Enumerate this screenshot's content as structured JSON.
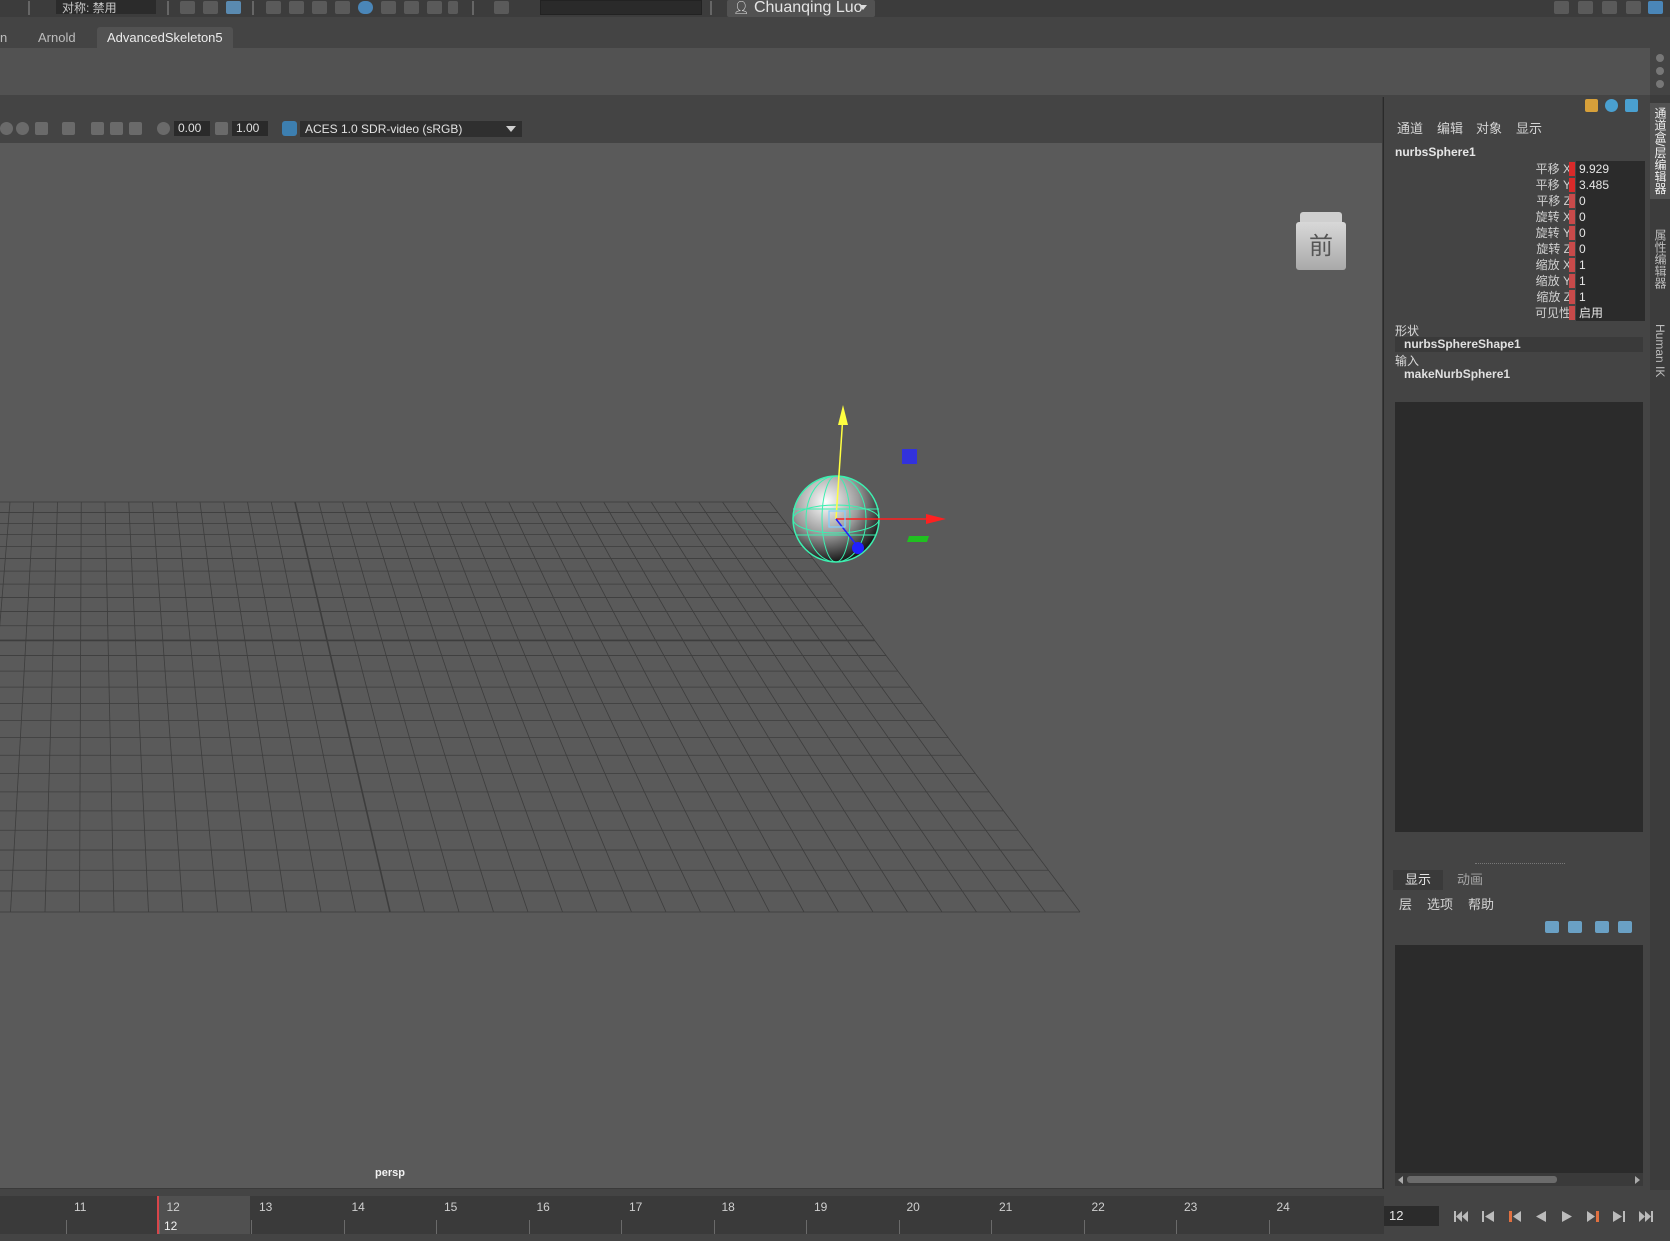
{
  "topbar": {
    "symmetry_label": "对称: 禁用",
    "search_value": "",
    "user_name": "Chuanqing Luo"
  },
  "shelf": {
    "tabs": [
      {
        "label": "n",
        "active": false
      },
      {
        "label": "Arnold",
        "active": false
      },
      {
        "label": "AdvancedSkeleton5",
        "active": true
      }
    ]
  },
  "viewport": {
    "exposure": "0.00",
    "gamma": "1.00",
    "color_space": "ACES 1.0 SDR-video (sRGB)",
    "camera": "persp",
    "view_cube_face": "前"
  },
  "channel_box": {
    "menu": [
      "通道",
      "编辑",
      "对象",
      "显示"
    ],
    "object_name": "nurbsSphere1",
    "attributes": [
      {
        "label": "平移 X",
        "value": "9.929"
      },
      {
        "label": "平移 Y",
        "value": "3.485"
      },
      {
        "label": "平移 Z",
        "value": "0"
      },
      {
        "label": "旋转 X",
        "value": "0"
      },
      {
        "label": "旋转 Y",
        "value": "0"
      },
      {
        "label": "旋转 Z",
        "value": "0"
      },
      {
        "label": "缩放 X",
        "value": "1"
      },
      {
        "label": "缩放 Y",
        "value": "1"
      },
      {
        "label": "缩放 Z",
        "value": "1"
      },
      {
        "label": "可见性",
        "value": "启用"
      }
    ],
    "shapes_header": "形状",
    "shape_node": "nurbsSphereShape1",
    "inputs_header": "输入",
    "input_node": "makeNurbSphere1"
  },
  "layer_editor": {
    "tabs": [
      {
        "label": "显示",
        "active": true
      },
      {
        "label": "动画",
        "active": false
      }
    ],
    "menu": [
      "层",
      "选项",
      "帮助"
    ]
  },
  "side_tabs": [
    "通道盒/层编辑器",
    "属性编辑器",
    "Human IK"
  ],
  "timeline": {
    "ticks": [
      "11",
      "12",
      "13",
      "14",
      "15",
      "16",
      "17",
      "18",
      "19",
      "20",
      "21",
      "22",
      "23",
      "24"
    ],
    "current_frame": "12",
    "current_field": "12"
  },
  "colors": {
    "viewport_bg": "#5a5a5a",
    "grid_line": "#3d3d3d",
    "wireframe": "#3cf0b0",
    "axis_x": "#ff2020",
    "axis_y": "#ffff40",
    "axis_z": "#2020ff",
    "keyed_attr": "#c84a4a",
    "time_cursor": "#d8454a"
  }
}
